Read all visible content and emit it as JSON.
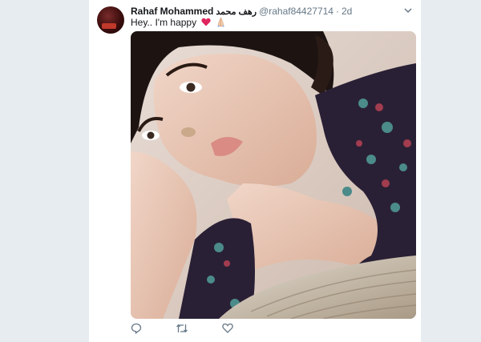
{
  "tweet": {
    "author_name": "Rahaf Mohammed",
    "author_name_arabic": "رهف محمد",
    "handle": "@rahaf84427714",
    "separator": "·",
    "time": "2d",
    "text": "Hey.. I'm happy",
    "emojis": [
      "heart-emoji",
      "praying-hands-emoji"
    ],
    "menu_icon": "chevron-down-icon"
  },
  "actions": [
    {
      "name": "reply",
      "icon": "reply-icon"
    },
    {
      "name": "retweet",
      "icon": "retweet-icon"
    },
    {
      "name": "like",
      "icon": "heart-icon"
    }
  ],
  "colors": {
    "background": "#e6ecf0",
    "card": "#ffffff",
    "text": "#14171a",
    "secondary": "#657786",
    "heart": "#e0245e"
  }
}
